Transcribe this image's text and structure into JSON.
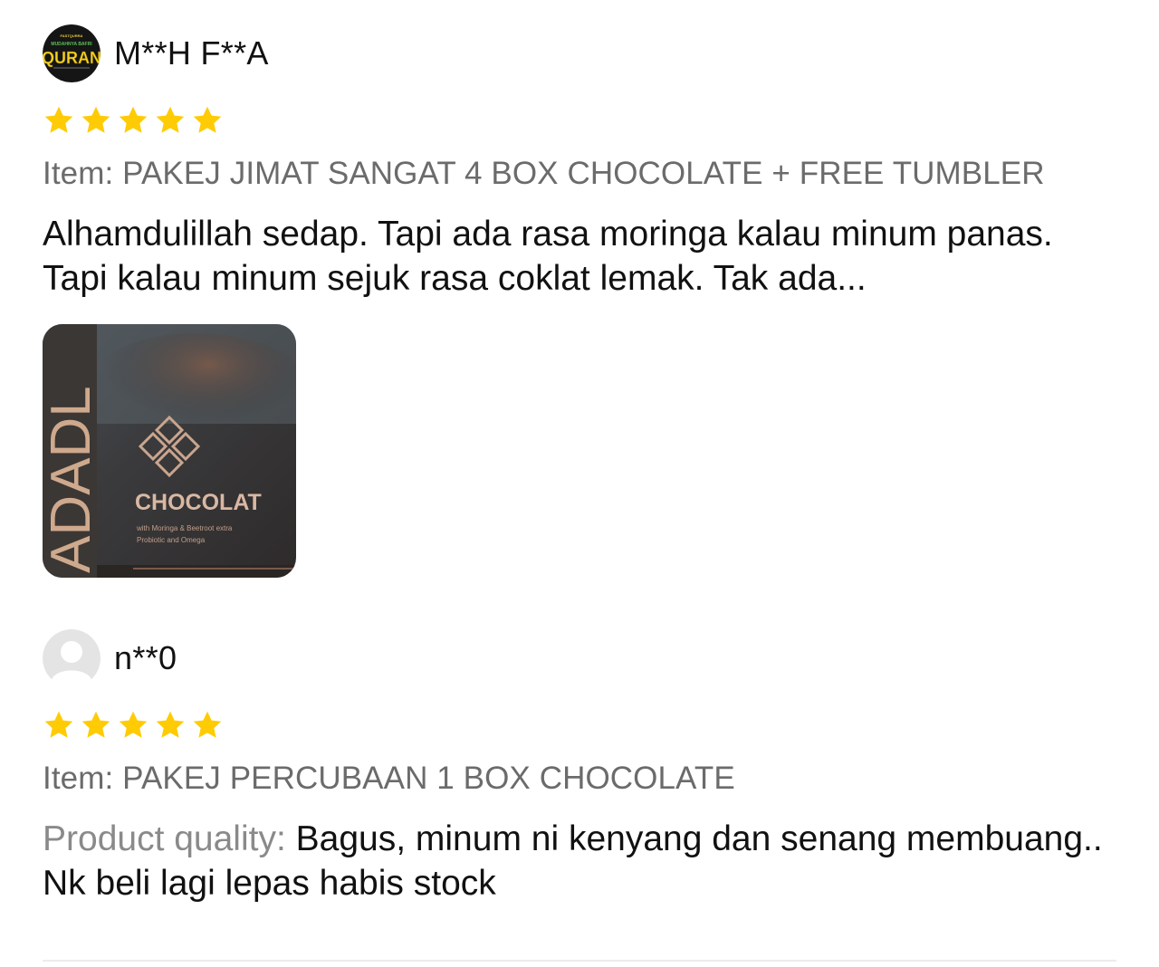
{
  "reviews": [
    {
      "username": "M**H F**A",
      "avatar_icon": "quran-logo-icon",
      "avatar_text": {
        "top": "FASTQURRA",
        "mid": "MUDAHNYA BAFRI",
        "big": "QURAN"
      },
      "rating": 5,
      "item": "Item: PAKEJ JIMAT SANGAT 4 BOX CHOCOLATE + FREE TUMBLER",
      "text": "Alhamdulillah sedap. Tapi ada rasa moringa kalau minum panas. Tapi kalau minum sejuk rasa coklat lemak. Tak ada...",
      "photo": {
        "brand_vertical": "ADADL",
        "product": "CHOCOLAT",
        "line1": "with Moringa & Beetroot extra",
        "line2": "Probiotic and Omega"
      }
    },
    {
      "username": "n**0",
      "avatar_icon": "default-user-icon",
      "rating": 5,
      "item": "Item: PAKEJ PERCUBAAN 1 BOX CHOCOLATE",
      "text_label": "Product quality:",
      "text": "Bagus, minum ni kenyang dan senang membuang.. Nk beli lagi lepas habis stock"
    }
  ],
  "colors": {
    "star": "#FFCB05",
    "muted": "#6b6b6b",
    "text": "#111111"
  }
}
